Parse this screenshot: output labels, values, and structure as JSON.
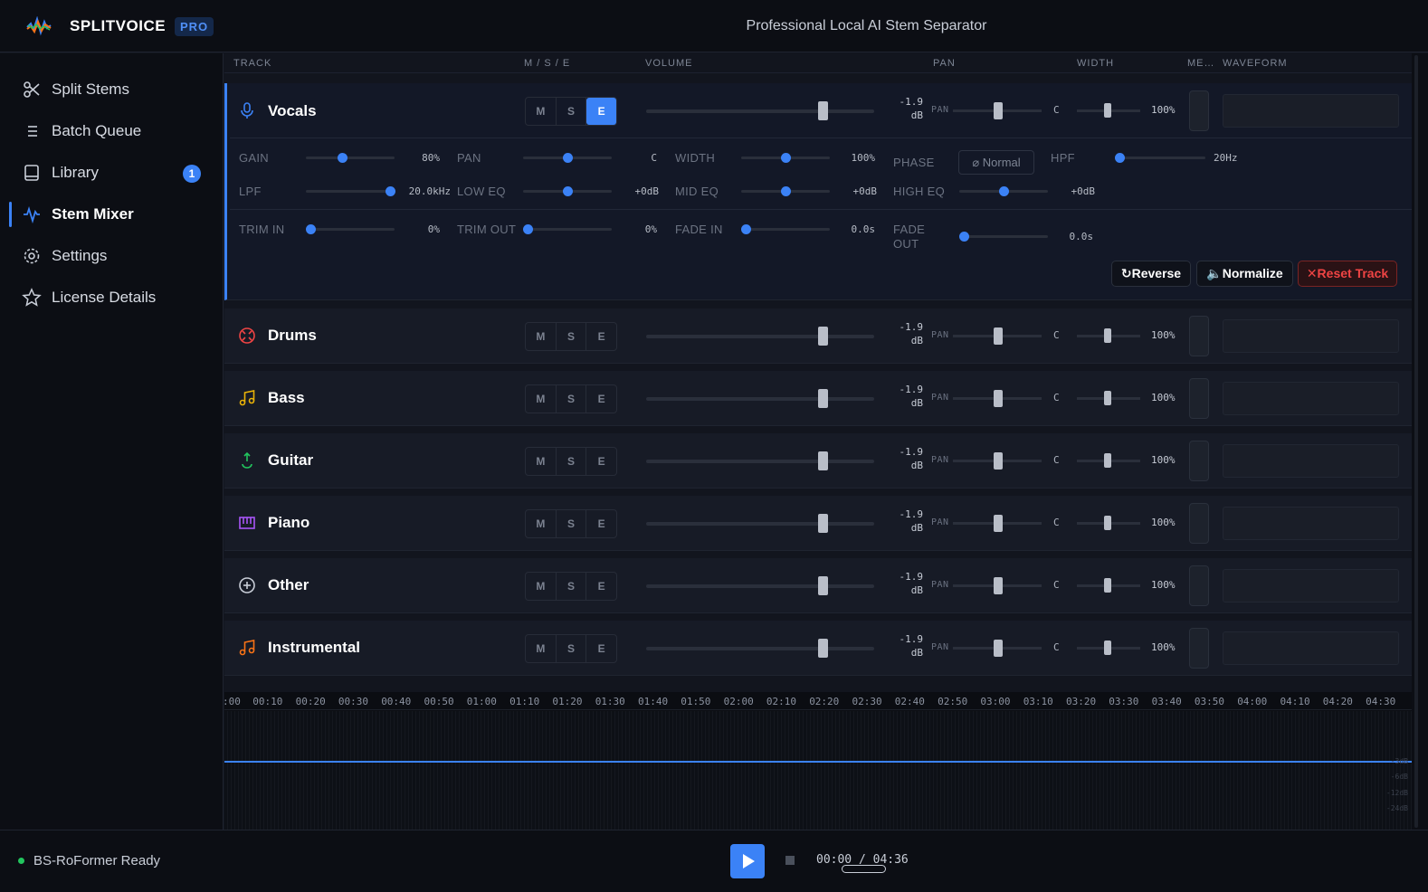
{
  "app": {
    "name": "SPLITVOICE",
    "badge": "PRO",
    "subtitle": "Professional Local AI Stem Separator"
  },
  "sidebar": {
    "items": [
      {
        "label": "Split Stems",
        "icon": "scissors-icon"
      },
      {
        "label": "Batch Queue",
        "icon": "list-icon"
      },
      {
        "label": "Library",
        "icon": "book-icon",
        "badge": "1"
      },
      {
        "label": "Stem Mixer",
        "icon": "waveform-icon",
        "active": true
      },
      {
        "label": "Settings",
        "icon": "gear-icon"
      },
      {
        "label": "License Details",
        "icon": "star-icon"
      }
    ]
  },
  "mixer": {
    "headers": {
      "track": "TRACK",
      "mse": "M / S / E",
      "volume": "VOLUME",
      "pan": "PAN",
      "width": "WIDTH",
      "meter": "ME…",
      "waveform": "WAVEFORM"
    },
    "mse_labels": [
      "M",
      "S",
      "E"
    ],
    "tracks": [
      {
        "name": "Vocals",
        "icon": "microphone-icon",
        "color": "#3b82f6",
        "db": "-1.9",
        "unit": "dB",
        "pan_label": "PAN",
        "pan": "C",
        "width": "100%",
        "volume_level": 0.78,
        "mse_active": "E",
        "expanded": true
      },
      {
        "name": "Drums",
        "icon": "drum-icon",
        "color": "#ef4444",
        "db": "-1.9",
        "unit": "dB",
        "pan_label": "PAN",
        "pan": "C",
        "width": "100%",
        "volume_level": 0.78
      },
      {
        "name": "Bass",
        "icon": "music-note-icon",
        "color": "#eab308",
        "db": "-1.9",
        "unit": "dB",
        "pan_label": "PAN",
        "pan": "C",
        "width": "100%",
        "volume_level": 0.78
      },
      {
        "name": "Guitar",
        "icon": "guitar-icon",
        "color": "#22c55e",
        "db": "-1.9",
        "unit": "dB",
        "pan_label": "PAN",
        "pan": "C",
        "width": "100%",
        "volume_level": 0.78
      },
      {
        "name": "Piano",
        "icon": "piano-icon",
        "color": "#a855f7",
        "db": "-1.9",
        "unit": "dB",
        "pan_label": "PAN",
        "pan": "C",
        "width": "100%",
        "volume_level": 0.78
      },
      {
        "name": "Other",
        "icon": "plus-circle-icon",
        "color": "#c9ced8",
        "db": "-1.9",
        "unit": "dB",
        "pan_label": "PAN",
        "pan": "C",
        "width": "100%",
        "volume_level": 0.78
      },
      {
        "name": "Instrumental",
        "icon": "music-notes-icon",
        "color": "#f97316",
        "db": "-1.9",
        "unit": "dB",
        "pan_label": "PAN",
        "pan": "C",
        "width": "100%",
        "volume_level": 0.78
      }
    ],
    "vocals_params": {
      "gain": {
        "label": "GAIN",
        "value": "80%"
      },
      "pan": {
        "label": "PAN",
        "value": "C"
      },
      "width": {
        "label": "WIDTH",
        "value": "100%"
      },
      "phase": {
        "label": "PHASE",
        "value": "⌀ Normal"
      },
      "hpf": {
        "label": "HPF",
        "value": "20Hz"
      },
      "lpf": {
        "label": "LPF",
        "value": "20.0kHz"
      },
      "low_eq": {
        "label": "LOW EQ",
        "value": "+0dB"
      },
      "mid_eq": {
        "label": "MID EQ",
        "value": "+0dB"
      },
      "high_eq": {
        "label": "HIGH EQ",
        "value": "+0dB"
      },
      "trim_in": {
        "label": "TRIM IN",
        "value": "0%"
      },
      "trim_out": {
        "label": "TRIM OUT",
        "value": "0%"
      },
      "fade_in": {
        "label": "FADE IN",
        "value": "0.0s"
      },
      "fade_out": {
        "label": "FADE OUT",
        "value": "0.0s"
      }
    },
    "actions": {
      "reverse": "↻Reverse",
      "normalize": "🔈Normalize",
      "reset": "✕Reset Track"
    }
  },
  "timeline": {
    "ticks": [
      ":00",
      "00:10",
      "00:20",
      "00:30",
      "00:40",
      "00:50",
      "01:00",
      "01:10",
      "01:20",
      "01:30",
      "01:40",
      "01:50",
      "02:00",
      "02:10",
      "02:20",
      "02:30",
      "02:40",
      "02:50",
      "03:00",
      "03:10",
      "03:20",
      "03:30",
      "03:40",
      "03:50",
      "04:00",
      "04:10",
      "04:20",
      "04:30"
    ],
    "db_marks": [
      "-3dB",
      "-6dB",
      "-12dB",
      "-24dB"
    ]
  },
  "status": {
    "model": "BS-RoFormer Ready",
    "time_current": "00:00",
    "time_separator": " / ",
    "time_total": "04:36"
  },
  "colors": {
    "accent": "#3b82f6",
    "danger": "#ef4444",
    "ready": "#22c55e"
  }
}
